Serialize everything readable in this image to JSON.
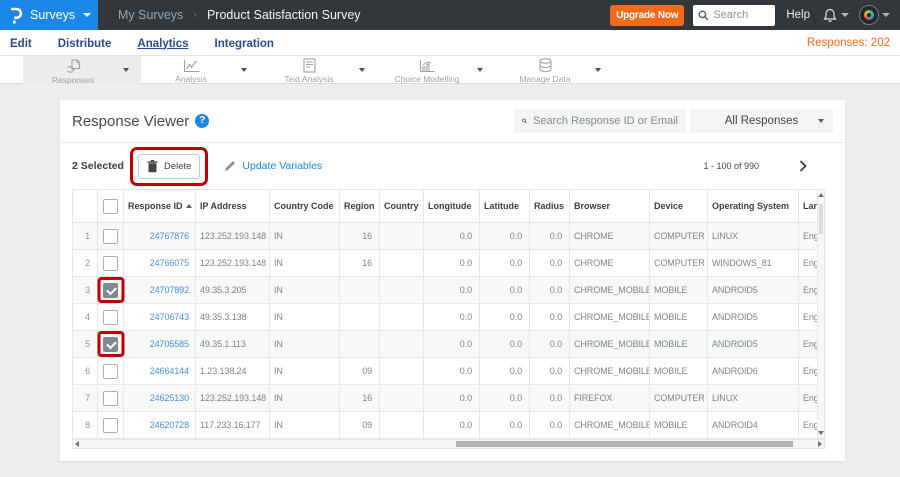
{
  "topbar": {
    "product_menu": "Surveys",
    "breadcrumb_parent": "My Surveys",
    "breadcrumb_separator": "›",
    "page_title": "Product Satisfaction Survey",
    "upgrade_label": "Upgrade Now",
    "search_placeholder": "Search",
    "help_label": "Help"
  },
  "nav": {
    "items": [
      "Edit",
      "Distribute",
      "Analytics",
      "Integration"
    ],
    "active": "Analytics",
    "responses_label": "Responses: 202"
  },
  "toolbar": {
    "items": [
      "Responses",
      "Analysis",
      "Text Analysis",
      "Choice Modelling",
      "Manage Data"
    ],
    "active": "Responses"
  },
  "viewer": {
    "title": "Response Viewer",
    "help_glyph": "?",
    "search_placeholder": "Search Response ID or Email",
    "filter_value": "All Responses",
    "selected_label": "2 Selected",
    "delete_label": "Delete",
    "update_variables_label": "Update Variables",
    "pagination": "1 - 100 of 990"
  },
  "annotations": {
    "color": "#c00000",
    "highlighted": [
      "delete-button",
      "row-3-checkbox",
      "row-5-checkbox"
    ]
  },
  "table": {
    "columns": [
      "",
      "",
      "Response ID",
      "IP Address",
      "Country Code",
      "Region",
      "Country",
      "Longitude",
      "Latitude",
      "Radius",
      "Browser",
      "Device",
      "Operating System",
      "Language"
    ],
    "sorted_column": "Response ID",
    "rows": [
      {
        "num": "1",
        "checked": false,
        "response_id": "24767876",
        "ip": "123.252.193.148",
        "country_code": "IN",
        "region": "16",
        "country": "",
        "longitude": "0.0",
        "latitude": "0.0",
        "radius": "0.0",
        "browser": "CHROME",
        "device": "COMPUTER",
        "os": "LINUX",
        "language": "English"
      },
      {
        "num": "2",
        "checked": false,
        "response_id": "24766075",
        "ip": "123.252.193.148",
        "country_code": "IN",
        "region": "16",
        "country": "",
        "longitude": "0.0",
        "latitude": "0.0",
        "radius": "0.0",
        "browser": "CHROME",
        "device": "COMPUTER",
        "os": "WINDOWS_81",
        "language": "English"
      },
      {
        "num": "3",
        "checked": true,
        "response_id": "24707892",
        "ip": "49.35.3.205",
        "country_code": "IN",
        "region": "",
        "country": "",
        "longitude": "0.0",
        "latitude": "0.0",
        "radius": "0.0",
        "browser": "CHROME_MOBILE",
        "device": "MOBILE",
        "os": "ANDROID5",
        "language": "English"
      },
      {
        "num": "4",
        "checked": false,
        "response_id": "24706743",
        "ip": "49.35.3.138",
        "country_code": "IN",
        "region": "",
        "country": "",
        "longitude": "0.0",
        "latitude": "0.0",
        "radius": "0.0",
        "browser": "CHROME_MOBILE",
        "device": "MOBILE",
        "os": "ANDROID5",
        "language": "English"
      },
      {
        "num": "5",
        "checked": true,
        "response_id": "24705585",
        "ip": "49.35.1.113",
        "country_code": "IN",
        "region": "",
        "country": "",
        "longitude": "0.0",
        "latitude": "0.0",
        "radius": "0.0",
        "browser": "CHROME_MOBILE",
        "device": "MOBILE",
        "os": "ANDROID5",
        "language": "English"
      },
      {
        "num": "6",
        "checked": false,
        "response_id": "24664144",
        "ip": "1.23.138.24",
        "country_code": "IN",
        "region": "09",
        "country": "",
        "longitude": "0.0",
        "latitude": "0.0",
        "radius": "0.0",
        "browser": "CHROME_MOBILE",
        "device": "MOBILE",
        "os": "ANDROID6",
        "language": "English"
      },
      {
        "num": "7",
        "checked": false,
        "response_id": "24625130",
        "ip": "123.252.193.148",
        "country_code": "IN",
        "region": "16",
        "country": "",
        "longitude": "0.0",
        "latitude": "0.0",
        "radius": "0.0",
        "browser": "FIREFOX",
        "device": "COMPUTER",
        "os": "LINUX",
        "language": "English"
      },
      {
        "num": "8",
        "checked": false,
        "response_id": "24620728",
        "ip": "117.233.16.177",
        "country_code": "IN",
        "region": "09",
        "country": "",
        "longitude": "0.0",
        "latitude": "0.0",
        "radius": "0.0",
        "browser": "CHROME_MOBILE",
        "device": "MOBILE",
        "os": "ANDROID4",
        "language": "English"
      }
    ]
  }
}
